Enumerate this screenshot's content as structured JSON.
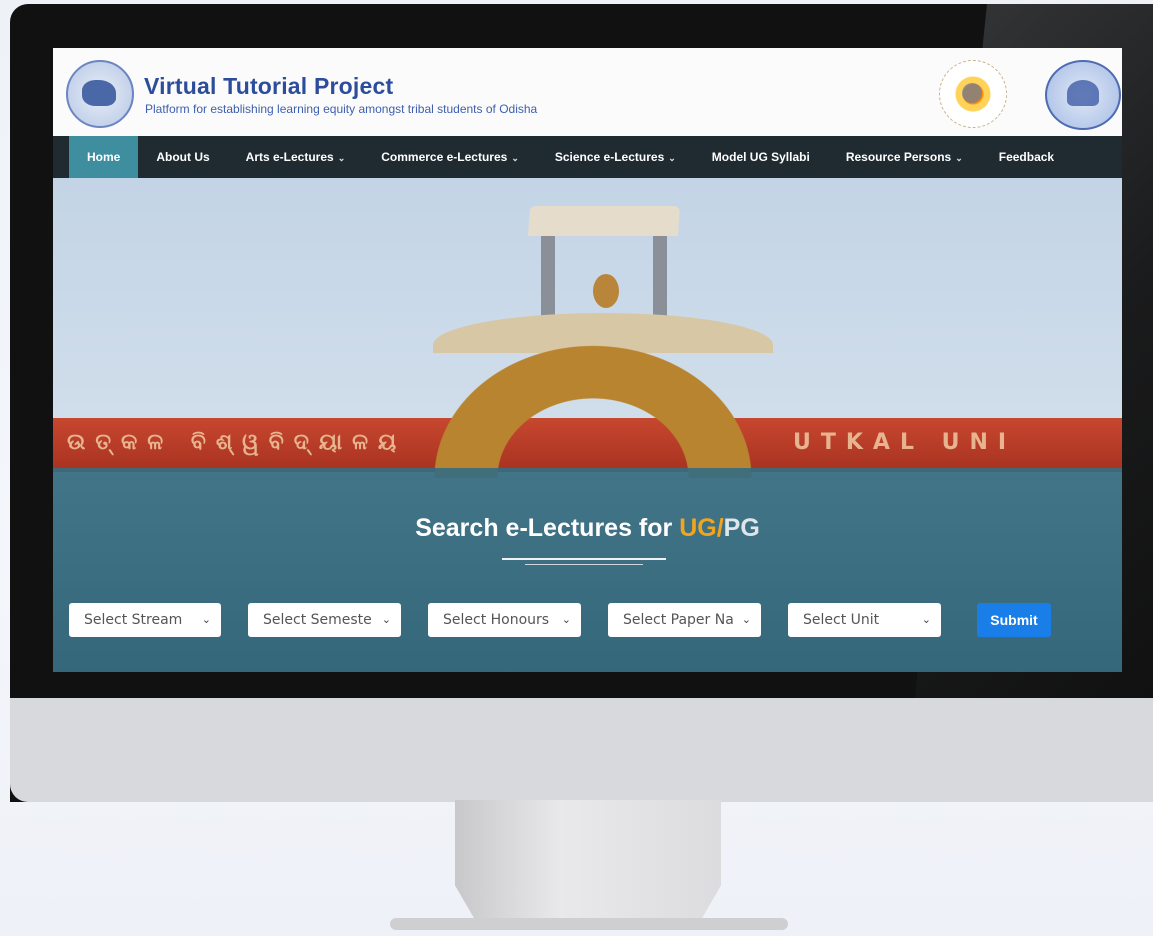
{
  "site": {
    "title": "Virtual Tutorial Project",
    "subtitle": "Platform for establishing learning equity amongst tribal students of Odisha"
  },
  "nav": {
    "items": [
      {
        "label": "Home",
        "dropdown": false,
        "active": true
      },
      {
        "label": "About Us",
        "dropdown": false,
        "active": false
      },
      {
        "label": "Arts e-Lectures",
        "dropdown": true,
        "active": false
      },
      {
        "label": "Commerce e-Lectures",
        "dropdown": true,
        "active": false
      },
      {
        "label": "Science e-Lectures",
        "dropdown": true,
        "active": false
      },
      {
        "label": "Model UG Syllabi",
        "dropdown": false,
        "active": false
      },
      {
        "label": "Resource Persons",
        "dropdown": true,
        "active": false
      },
      {
        "label": "Feedback",
        "dropdown": false,
        "active": false
      }
    ],
    "dropdown_icon": "chevron-down-icon"
  },
  "hero": {
    "wall_text_left": "ଉତ୍କଳ ବିଶ୍ୱବିଦ୍ୟାଳୟ",
    "wall_text_right": "UTKAL UNI"
  },
  "search": {
    "title_prefix": "Search e-Lectures for ",
    "title_ug": "UG/",
    "title_pg": "PG",
    "selects": [
      {
        "label": "Select Stream"
      },
      {
        "label": "Select Semeste"
      },
      {
        "label": "Select Honours"
      },
      {
        "label": "Select Paper Na"
      },
      {
        "label": "Select Unit"
      }
    ],
    "submit_label": "Submit"
  },
  "colors": {
    "nav_bg": "#202a31",
    "nav_active": "#3e8ea0",
    "brand_blue": "#2c4c9c",
    "accent_orange": "#f2a41c",
    "submit_blue": "#1a7ee8",
    "overlay_teal": "#366c80"
  }
}
